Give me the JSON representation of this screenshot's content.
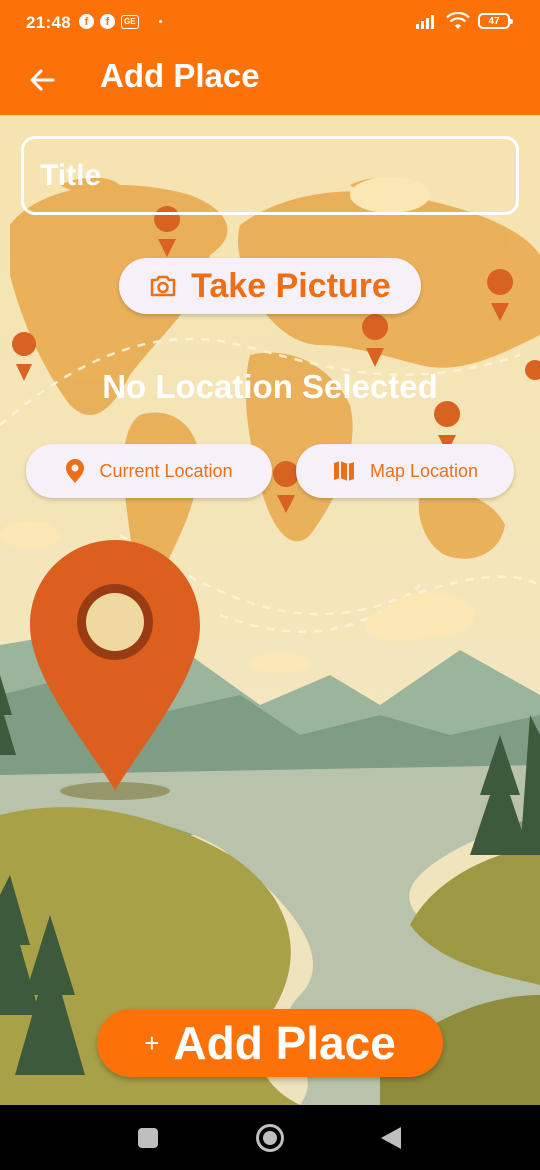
{
  "status_bar": {
    "time": "21:48",
    "fb_letter": "f",
    "ge_label": "GE",
    "battery": "47"
  },
  "app_bar": {
    "title": "Add Place"
  },
  "form": {
    "title_placeholder": "Title",
    "take_picture_label": "Take Picture",
    "no_location_text": "No Location Selected",
    "current_location_label": "Current Location",
    "map_location_label": "Map Location",
    "add_place_label": "Add Place",
    "add_place_plus": "+"
  },
  "icons": {
    "back": "arrow-back-icon",
    "camera": "camera-icon",
    "location": "location-pin-icon",
    "map": "map-icon"
  },
  "colors": {
    "primary": "#fd7208",
    "accent_text": "#ec6f18",
    "button_bg": "#f6f1f8"
  }
}
